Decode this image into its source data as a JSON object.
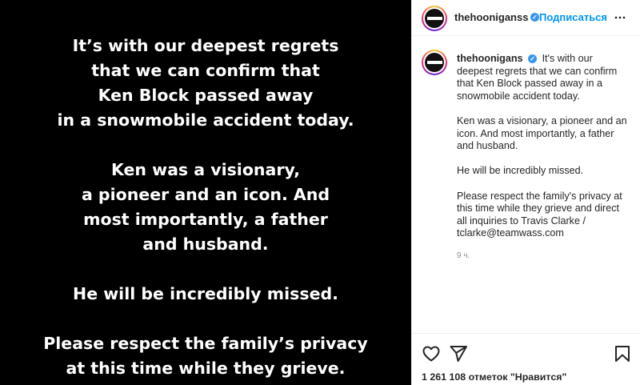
{
  "media": {
    "paragraphs": [
      [
        "It’s with our deepest regrets",
        "that we can confirm that",
        "Ken Block passed away",
        "in a snowmobile accident today."
      ],
      [
        "Ken was a visionary,",
        "a pioneer and an icon. And",
        "most importantly, a father",
        "and husband."
      ],
      [
        "He will be incredibly missed."
      ],
      [
        "Please respect the family’s privacy",
        "at this time while they grieve."
      ]
    ]
  },
  "header": {
    "username": "thehooniganss",
    "follow_label": "Подписаться",
    "separator": "•"
  },
  "caption": {
    "username": "thehoonigans",
    "first": "It's with our deepest regrets that we can confirm that Ken Block passed away in a snowmobile accident today.",
    "second": "Ken was a visionary, a pioneer and an icon. And most importantly, a father and husband.",
    "third": "He will be incredibly missed.",
    "fourth": "Please respect the family's privacy at this time while they grieve and direct all inquiries to Travis Clarke / tclarke@teamwass.com",
    "timestamp": "9 ч."
  },
  "actions": {
    "likes": "1 261 108 отметок \"Нравится\""
  },
  "icons": {
    "verified": "verified-badge-icon",
    "more": "more-options-icon",
    "like": "heart-icon",
    "share": "paper-plane-icon",
    "save": "bookmark-icon"
  },
  "colors": {
    "link": "#0095f6",
    "verified": "#3897f0",
    "muted": "#8e8e8e"
  }
}
